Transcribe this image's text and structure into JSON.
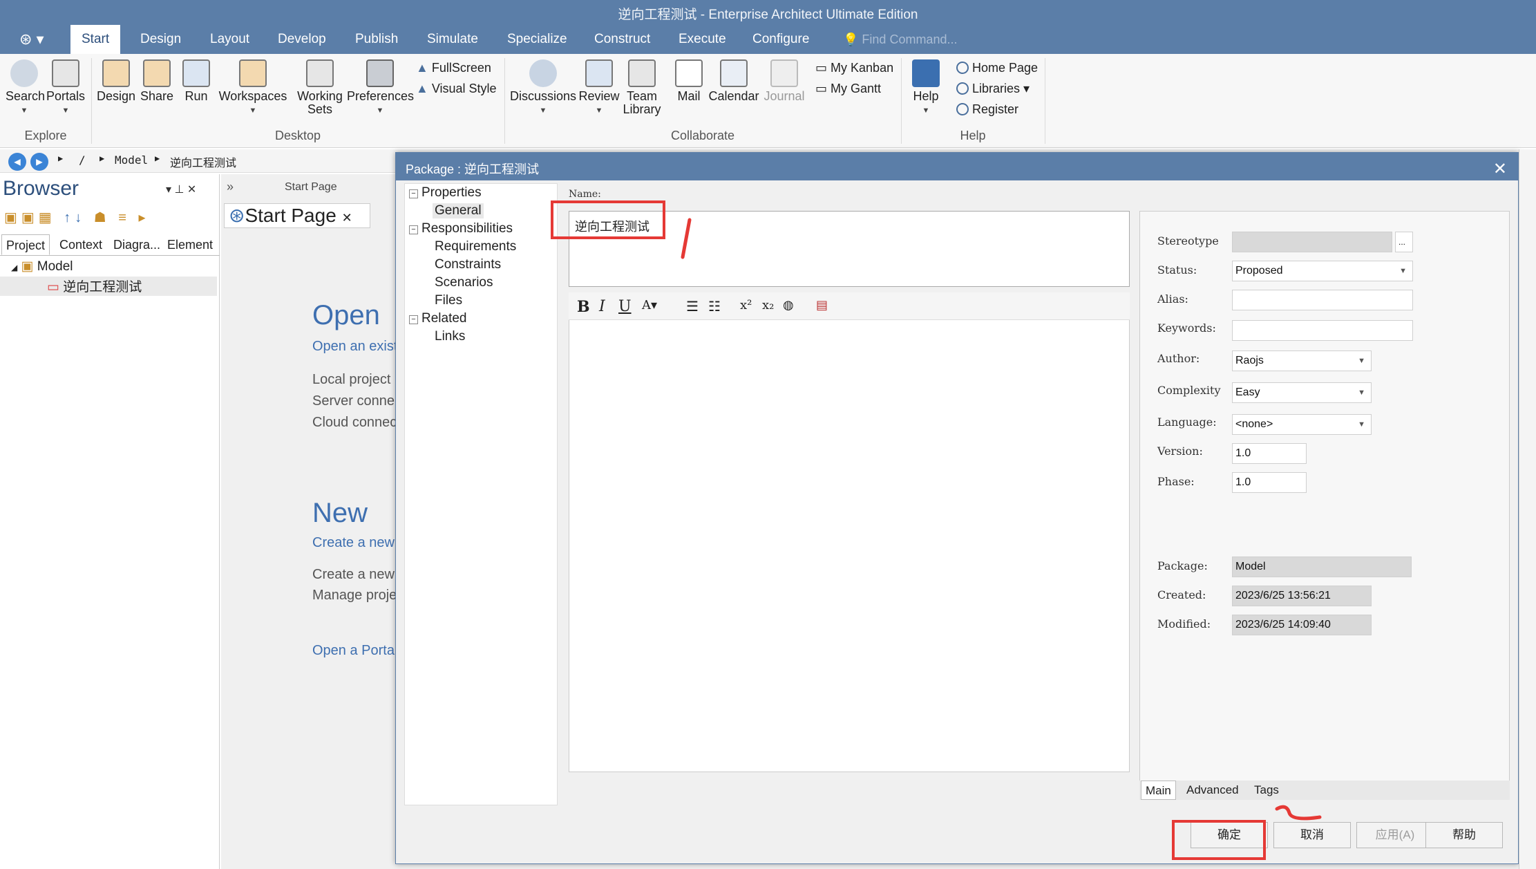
{
  "window": {
    "title": "逆向工程测试 - Enterprise Architect Ultimate Edition"
  },
  "ribbon_tabs": [
    "Start",
    "Design",
    "Layout",
    "Develop",
    "Publish",
    "Simulate",
    "Specialize",
    "Construct",
    "Execute",
    "Configure"
  ],
  "find_command": "Find Command...",
  "ribbon": {
    "explore": {
      "search": "Search",
      "portals": "Portals",
      "group": "Explore"
    },
    "desktop": {
      "design": "Design",
      "share": "Share",
      "run": "Run",
      "workspaces": "Workspaces",
      "working_sets_1": "Working",
      "working_sets_2": "Sets",
      "preferences": "Preferences",
      "fullscreen": "FullScreen",
      "visual_style": "Visual Style",
      "group": "Desktop"
    },
    "collaborate": {
      "discussions": "Discussions",
      "review": "Review",
      "team_library_1": "Team",
      "team_library_2": "Library",
      "mail": "Mail",
      "calendar": "Calendar",
      "journal": "Journal",
      "my_kanban": "My Kanban",
      "my_gantt": "My Gantt",
      "group": "Collaborate"
    },
    "help": {
      "help": "Help",
      "home_page": "Home Page",
      "libraries": "Libraries",
      "register": "Register",
      "group": "Help"
    }
  },
  "nav": {
    "root": "/",
    "model": "Model",
    "package": "逆向工程测试"
  },
  "browser": {
    "title": "Browser",
    "tabs": [
      "Project",
      "Context",
      "Diagra...",
      "Element"
    ],
    "tree": {
      "root": "Model",
      "child": "逆向工程测试"
    }
  },
  "start_page": {
    "breadcrumb": "Start Page",
    "tab": "Start Page",
    "open_heading": "Open",
    "open_link": "Open an exist",
    "local": "Local project",
    "server": "Server conne",
    "cloud": "Cloud connec",
    "new_heading": "New",
    "new_link": "Create a new",
    "create_text": "Create a new",
    "manage_text": "Manage proje",
    "portal_link": "Open a Portal"
  },
  "dialog": {
    "title": "Package : 逆向工程测试",
    "tree": [
      "Properties",
      "General",
      "Responsibilities",
      "Requirements",
      "Constraints",
      "Scenarios",
      "Files",
      "Related",
      "Links"
    ],
    "name_label": "Name:",
    "name_value": "逆向工程测试",
    "toolbar": {
      "bold": "B",
      "italic": "I",
      "underline": "U"
    },
    "props": {
      "stereotype_label": "Stereotype",
      "stereotype_btn": "...",
      "status_label": "Status:",
      "status_value": "Proposed",
      "alias_label": "Alias:",
      "keywords_label": "Keywords:",
      "author_label": "Author:",
      "author_value": "Raojs",
      "complexity_label": "Complexity",
      "complexity_value": "Easy",
      "language_label": "Language:",
      "language_value": "<none>",
      "version_label": "Version:",
      "version_value": "1.0",
      "phase_label": "Phase:",
      "phase_value": "1.0",
      "package_label": "Package:",
      "package_value": "Model",
      "created_label": "Created:",
      "created_value": "2023/6/25 13:56:21",
      "modified_label": "Modified:",
      "modified_value": "2023/6/25 14:09:40"
    },
    "bottom_tabs": [
      "Main",
      "Advanced",
      "Tags"
    ],
    "buttons": {
      "ok": "确定",
      "cancel": "取消",
      "apply": "应用(A)",
      "help": "帮助"
    }
  },
  "colors": {
    "titlebar": "#5b7ea8",
    "accent": "#3e6fb0",
    "annotation": "#e53935"
  }
}
